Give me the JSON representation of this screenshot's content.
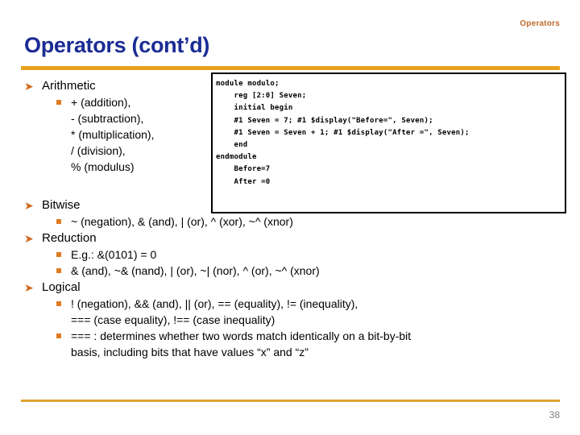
{
  "header": {
    "corner_label": "Operators",
    "title": "Operators (cont’d)",
    "page_number": "38"
  },
  "colors": {
    "title_blue": "#1B2C94",
    "rule_orange": "#E8A21E",
    "corner_label_orange": "#C0692A",
    "bullet_arrow_orange": "#D2691E",
    "bullet_square_orange": "#E07B22",
    "page_number_gray": "#808080"
  },
  "code_box": {
    "lines": [
      "module modulo;",
      "    reg [2:0] Seven;",
      "    initial begin",
      "    #1 Seven = 7; #1 $display(\"Before=\", Seven);",
      "    #1 Seven = Seven + 1; #1 $display(\"After =\", Seven);",
      "    end",
      "endmodule",
      "    Before=7",
      "    After =0"
    ]
  },
  "outline": {
    "arithmetic": {
      "heading": "Arithmetic",
      "items": [
        "+ (addition),",
        "- (subtraction),",
        "* (multiplication),",
        "/ (division),",
        "% (modulus)"
      ]
    },
    "bitwise": {
      "heading": "Bitwise",
      "items": [
        "~ (negation), & (and), | (or), ^ (xor), ~^ (xnor)"
      ]
    },
    "reduction": {
      "heading": "Reduction",
      "items": [
        "E.g.: &(0101) = 0",
        "& (and), ~& (nand), | (or), ~| (nor), ^ (or), ~^ (xnor)"
      ]
    },
    "logical": {
      "heading": "Logical",
      "item1_line1": "! (negation), && (and), || (or), == (equality), != (inequality),",
      "item1_line2": "=== (case equality), !== (case inequality)",
      "item2_line1": "=== : determines whether two words match identically on a bit-by-bit",
      "item2_line2": "basis, including bits that have values “x” and “z”"
    }
  },
  "icons": {
    "arrow_bullet": "➤",
    "square_bullet": "square-bullet-icon"
  }
}
